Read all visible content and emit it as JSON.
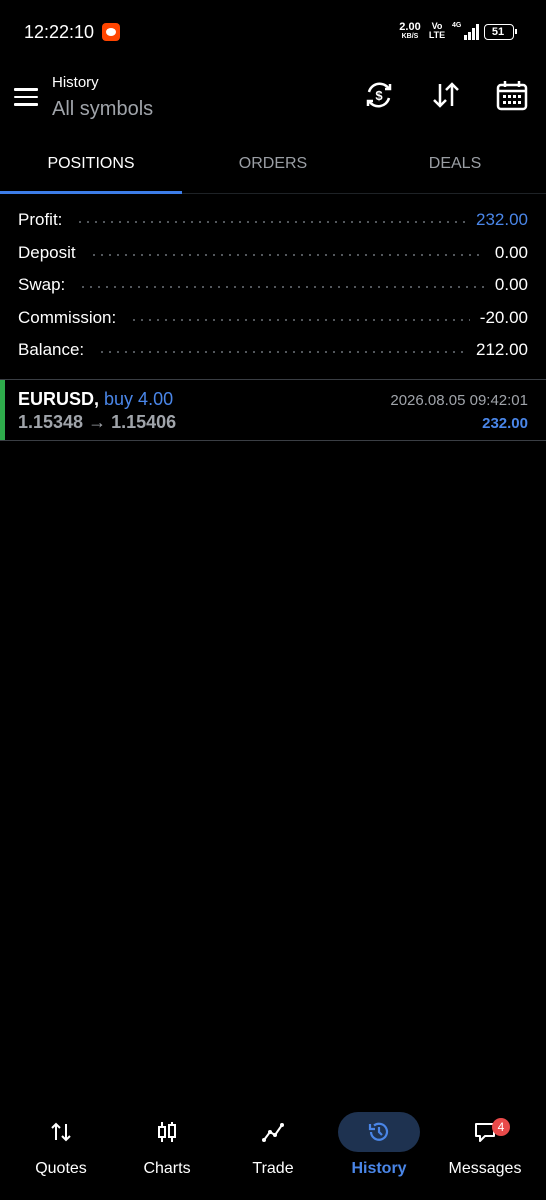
{
  "status_bar": {
    "time": "12:22:10",
    "net_speed": "2.00",
    "net_unit": "KB/S",
    "volte": "Vo LTE",
    "network": "4G",
    "battery": "51"
  },
  "app_bar": {
    "title": "History",
    "subtitle": "All symbols"
  },
  "tabs": [
    {
      "label": "POSITIONS",
      "active": true
    },
    {
      "label": "ORDERS",
      "active": false
    },
    {
      "label": "DEALS",
      "active": false
    }
  ],
  "summary": [
    {
      "label": "Profit:",
      "value": "232.00",
      "color": "#4a86e8"
    },
    {
      "label": "Deposit",
      "value": "0.00"
    },
    {
      "label": "Swap:",
      "value": "0.00"
    },
    {
      "label": "Commission:",
      "value": "-20.00"
    },
    {
      "label": "Balance:",
      "value": "212.00"
    }
  ],
  "positions": [
    {
      "symbol": "EURUSD,",
      "type": "buy 4.00",
      "prices": "1.15348 → 1.15406",
      "time": "2026.08.05 09:42:01",
      "profit": "232.00"
    }
  ],
  "bottom_nav": [
    {
      "label": "Quotes",
      "icon": "quotes-icon",
      "active": false
    },
    {
      "label": "Charts",
      "icon": "charts-icon",
      "active": false
    },
    {
      "label": "Trade",
      "icon": "trade-icon",
      "active": false
    },
    {
      "label": "History",
      "icon": "history-icon",
      "active": true
    },
    {
      "label": "Messages",
      "icon": "messages-icon",
      "active": false,
      "badge": "4"
    }
  ],
  "colors": {
    "accent": "#4a86e8",
    "buy_bar": "#2eab4b",
    "badge": "#e84a4a"
  }
}
